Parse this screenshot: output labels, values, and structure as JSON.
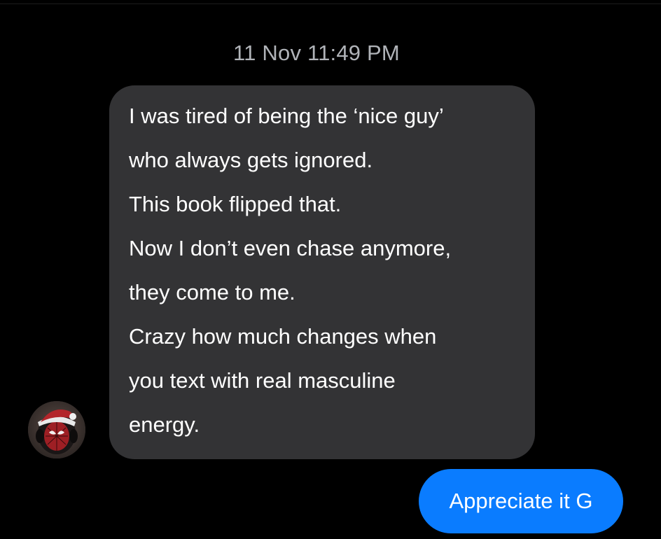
{
  "chat": {
    "timestamp": "11 Nov 11:49 PM",
    "incoming_message": {
      "lines": [
        "I was tired of being the ‘nice guy’",
        "who always gets ignored.",
        "This book flipped that.",
        "Now I don’t even chase anymore,",
        "they come to me.",
        "Crazy how much changes when",
        "you text with real masculine",
        "energy."
      ],
      "avatar_icon": "spiderman-santa-avatar-icon"
    },
    "outgoing_message": {
      "text": "Appreciate it G"
    }
  },
  "colors": {
    "background": "#000000",
    "incoming_bubble": "#333335",
    "outgoing_bubble": "#0a7cff",
    "timestamp_text": "#b0b3b8",
    "message_text": "#ffffff"
  }
}
